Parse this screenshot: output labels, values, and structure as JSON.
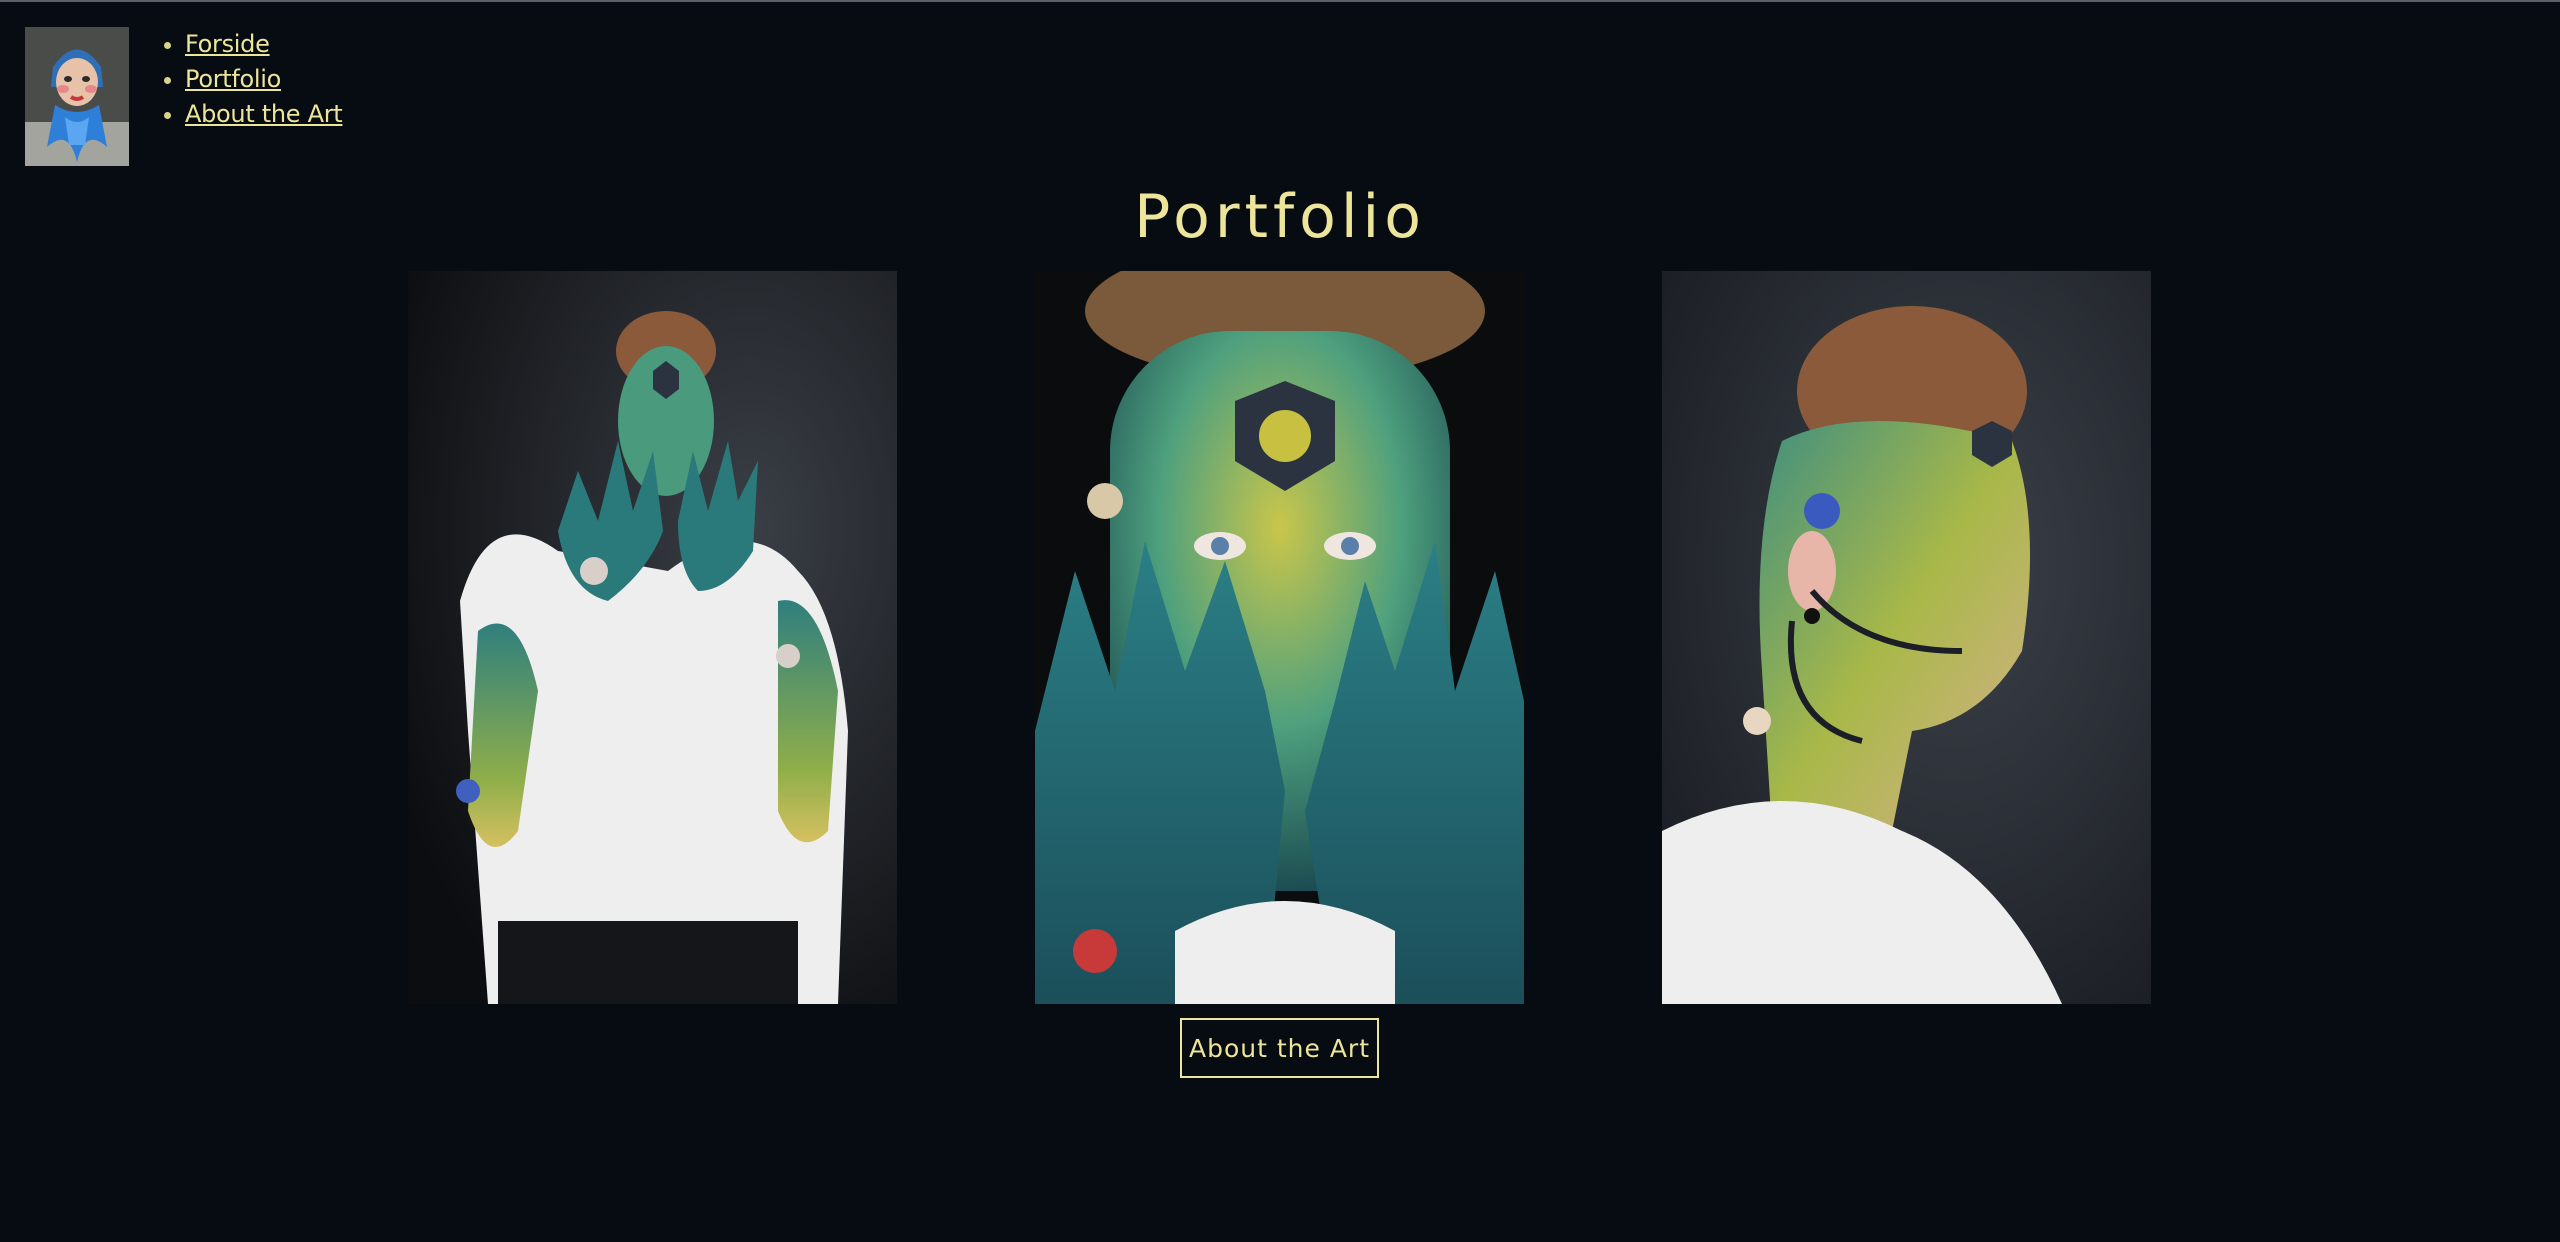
{
  "nav": {
    "items": [
      {
        "label": "Forside"
      },
      {
        "label": "Portfolio"
      },
      {
        "label": "About the Art"
      }
    ]
  },
  "page": {
    "title": "Portfolio"
  },
  "gallery": {
    "photos": [
      {
        "subject": "model covering face with painted hands"
      },
      {
        "subject": "close-up of painted face behind hands"
      },
      {
        "subject": "profile of painted face and neck"
      }
    ]
  },
  "cta": {
    "label": "About the Art"
  },
  "colors": {
    "background": "#070b12",
    "accent": "#ece59a",
    "paint_teal": "#2f7f7e",
    "paint_yellow": "#c9c64a"
  }
}
